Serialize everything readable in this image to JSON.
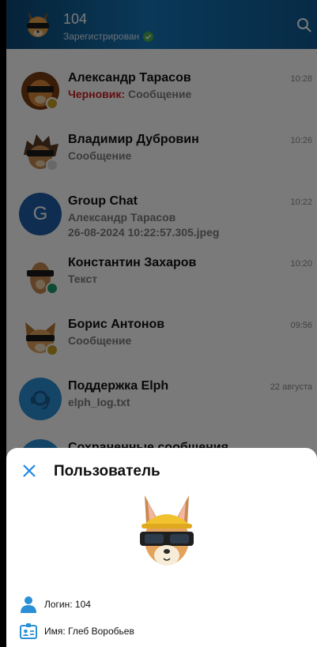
{
  "header": {
    "title": "104",
    "status": "Зарегистрирован"
  },
  "chats": [
    {
      "name": "Александр Тарасов",
      "draft_label": "Черновик:",
      "message": "Сообщение",
      "time": "10:28",
      "status_color": "#c9a227"
    },
    {
      "name": "Владимир Дубровин",
      "message": "Сообщение",
      "time": "10:26",
      "status_color": "#d9d9d9"
    },
    {
      "name": "Group Chat",
      "avatar_letter": "G",
      "message": "Александр Тарасов",
      "message2": "26-08-2024 10:22:57.305.jpeg",
      "time": "10:22"
    },
    {
      "name": "Константин Захаров",
      "message": "Текст",
      "time": "10:20",
      "status_color": "#1f9e6d"
    },
    {
      "name": "Борис Антонов",
      "message": "Сообщение",
      "time": "09:56",
      "status_color": "#c9a227"
    },
    {
      "name": "Поддержка Elph",
      "message": "elph_log.txt",
      "time": "22 августа"
    },
    {
      "name": "Сохраненные сообщения"
    }
  ],
  "sheet": {
    "title": "Пользователь",
    "login": "Логин: 104",
    "name": "Имя: Глеб Воробьев"
  },
  "colors": {
    "header": "#1576b8",
    "accent": "#1e88e5",
    "draft": "#cc1f1f"
  }
}
